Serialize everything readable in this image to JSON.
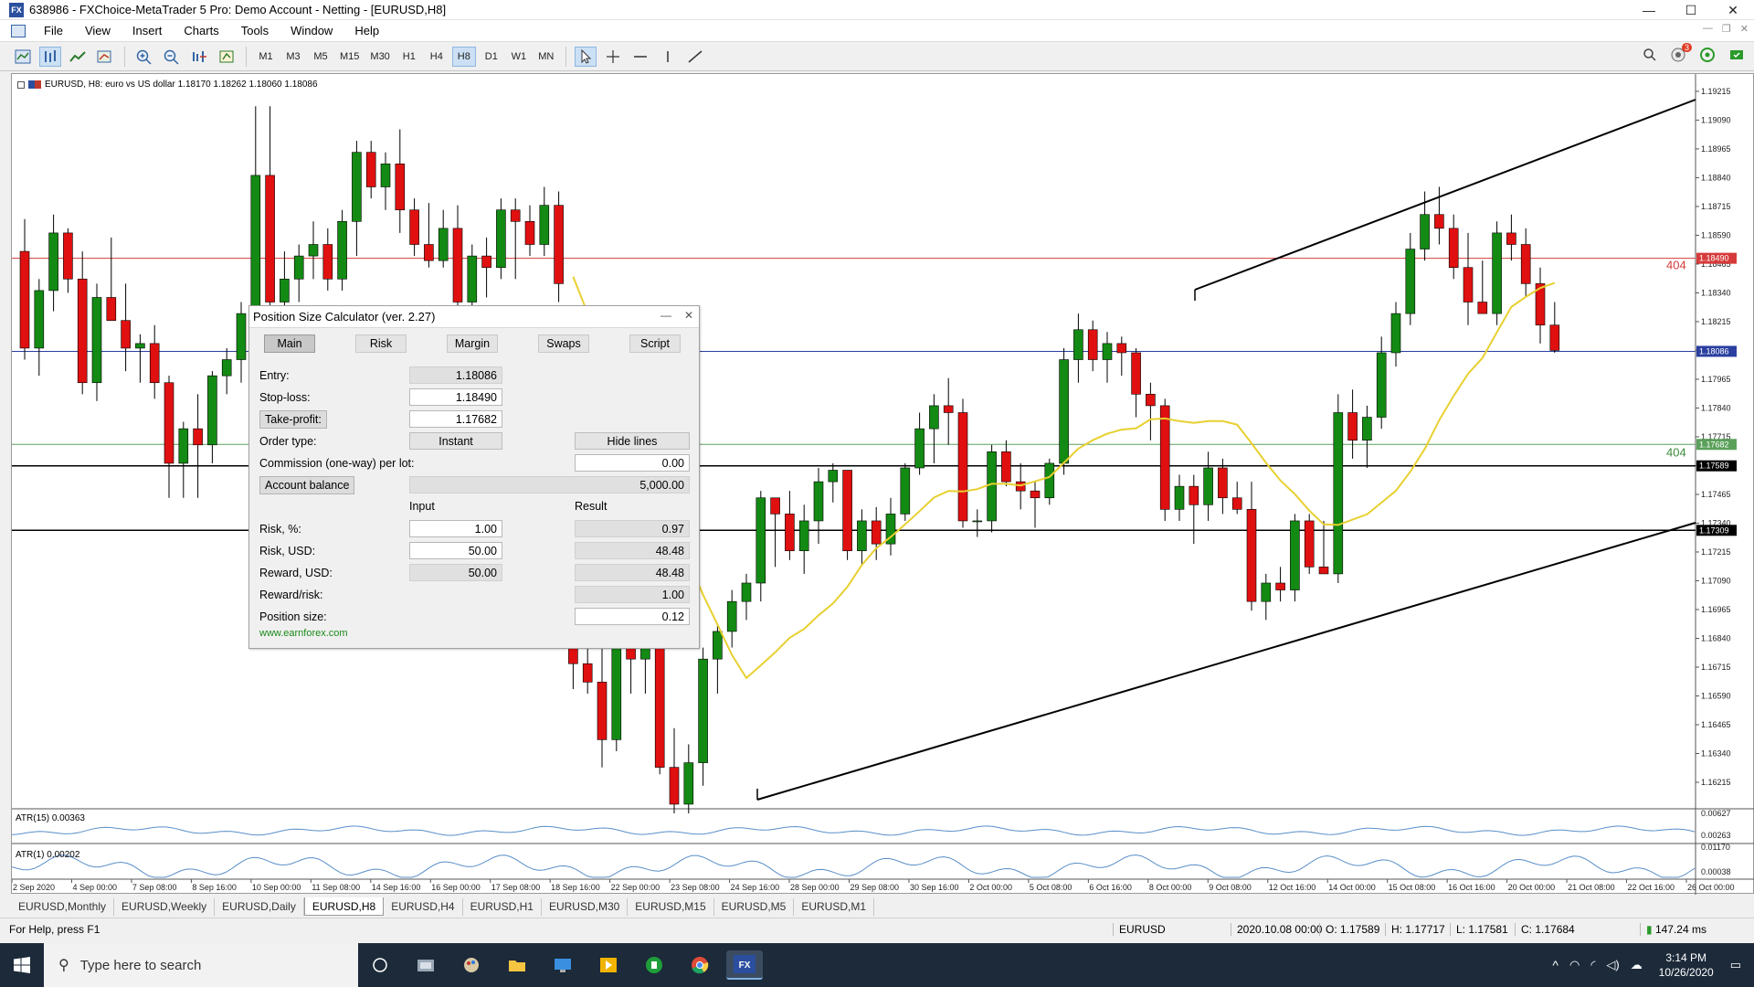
{
  "window": {
    "title": "638986 - FXChoice-MetaTrader 5 Pro: Demo Account - Netting - [EURUSD,H8]",
    "controls": [
      "—",
      "☐",
      "✕"
    ]
  },
  "menu": [
    "File",
    "View",
    "Insert",
    "Charts",
    "Tools",
    "Window",
    "Help"
  ],
  "toolbar": {
    "timeframes": [
      "M1",
      "M3",
      "M5",
      "M15",
      "M30",
      "H1",
      "H4",
      "H8",
      "D1",
      "W1",
      "MN"
    ],
    "active_timeframe": "H8",
    "notification_count": "3"
  },
  "chart": {
    "header": "EURUSD, H8:  euro vs US dollar  1.18170 1.18262 1.18060 1.18086",
    "price_axis": [
      "1.19215",
      "1.19090",
      "1.18965",
      "1.18840",
      "1.18715",
      "1.18590",
      "1.18465",
      "1.18340",
      "1.18215",
      "1.18090",
      "1.17965",
      "1.17840",
      "1.17715",
      "1.17590",
      "1.17465",
      "1.17340",
      "1.17215",
      "1.17090",
      "1.16965",
      "1.16840",
      "1.16715",
      "1.16590",
      "1.16465",
      "1.16340",
      "1.16215"
    ],
    "price_tags": {
      "stop_loss": "1.18490",
      "current": "1.18086",
      "take_profit": "1.17682",
      "line_1": "1.17589",
      "line_2": "1.17309"
    },
    "line_labels": {
      "sl_points": "404",
      "tp_points": "404"
    },
    "time_axis": [
      "2 Sep 2020",
      "4 Sep 00:00",
      "7 Sep 08:00",
      "8 Sep 16:00",
      "10 Sep 00:00",
      "11 Sep 08:00",
      "14 Sep 16:00",
      "16 Sep 00:00",
      "17 Sep 08:00",
      "18 Sep 16:00",
      "22 Sep 00:00",
      "23 Sep 08:00",
      "24 Sep 16:00",
      "28 Sep 00:00",
      "29 Sep 08:00",
      "30 Sep 16:00",
      "2 Oct 00:00",
      "5 Oct 08:00",
      "6 Oct 16:00",
      "8 Oct 00:00",
      "9 Oct 08:00",
      "12 Oct 16:00",
      "14 Oct 00:00",
      "15 Oct 08:00",
      "16 Oct 16:00",
      "20 Oct 00:00",
      "21 Oct 08:00",
      "22 Oct 16:00",
      "26 Oct 00:00"
    ],
    "atr15": {
      "label": "ATR(15) 0.00363",
      "axis": [
        "0.00627",
        "0.00263"
      ]
    },
    "atr1": {
      "label": "ATR(1) 0.00202",
      "axis": [
        "0.01170",
        "0.00038"
      ]
    }
  },
  "chart_data": {
    "type": "candlestick",
    "symbol": "EURUSD",
    "timeframe": "H8",
    "ylim": [
      1.161,
      1.1929
    ],
    "candles": [
      [
        1.1852,
        1.1866,
        1.1805,
        1.181
      ],
      [
        1.181,
        1.184,
        1.1798,
        1.1835
      ],
      [
        1.1835,
        1.1868,
        1.1826,
        1.186
      ],
      [
        1.186,
        1.1862,
        1.1834,
        1.184
      ],
      [
        1.184,
        1.1852,
        1.179,
        1.1795
      ],
      [
        1.1795,
        1.1838,
        1.1787,
        1.1832
      ],
      [
        1.1832,
        1.1858,
        1.1827,
        1.1822
      ],
      [
        1.1822,
        1.1838,
        1.18,
        1.181
      ],
      [
        1.181,
        1.1816,
        1.1795,
        1.1812
      ],
      [
        1.1812,
        1.182,
        1.1788,
        1.1795
      ],
      [
        1.1795,
        1.1798,
        1.1745,
        1.176
      ],
      [
        1.176,
        1.1778,
        1.1745,
        1.1775
      ],
      [
        1.1775,
        1.179,
        1.1745,
        1.1768
      ],
      [
        1.1768,
        1.18,
        1.176,
        1.1798
      ],
      [
        1.1798,
        1.181,
        1.179,
        1.1805
      ],
      [
        1.1805,
        1.183,
        1.1795,
        1.1825
      ],
      [
        1.1825,
        1.1915,
        1.182,
        1.1885
      ],
      [
        1.1885,
        1.1915,
        1.182,
        1.183
      ],
      [
        1.183,
        1.1852,
        1.181,
        1.184
      ],
      [
        1.184,
        1.1855,
        1.183,
        1.185
      ],
      [
        1.185,
        1.1865,
        1.184,
        1.1855
      ],
      [
        1.1855,
        1.1862,
        1.1835,
        1.184
      ],
      [
        1.184,
        1.187,
        1.1835,
        1.1865
      ],
      [
        1.1865,
        1.19,
        1.185,
        1.1895
      ],
      [
        1.1895,
        1.19,
        1.1875,
        1.188
      ],
      [
        1.188,
        1.1895,
        1.187,
        1.189
      ],
      [
        1.189,
        1.1905,
        1.186,
        1.187
      ],
      [
        1.187,
        1.1875,
        1.185,
        1.1855
      ],
      [
        1.1855,
        1.1873,
        1.1845,
        1.1848
      ],
      [
        1.1848,
        1.187,
        1.1845,
        1.1862
      ],
      [
        1.1862,
        1.1872,
        1.182,
        1.183
      ],
      [
        1.183,
        1.1855,
        1.1825,
        1.185
      ],
      [
        1.185,
        1.1858,
        1.1832,
        1.1845
      ],
      [
        1.1845,
        1.1875,
        1.184,
        1.187
      ],
      [
        1.187,
        1.1875,
        1.184,
        1.1865
      ],
      [
        1.1865,
        1.1872,
        1.185,
        1.1855
      ],
      [
        1.1855,
        1.188,
        1.185,
        1.1872
      ],
      [
        1.1872,
        1.1878,
        1.183,
        1.1838
      ],
      [
        1.1712,
        1.1725,
        1.1662,
        1.1673
      ],
      [
        1.1673,
        1.1688,
        1.166,
        1.1665
      ],
      [
        1.1665,
        1.1682,
        1.1628,
        1.164
      ],
      [
        1.164,
        1.169,
        1.1635,
        1.1685
      ],
      [
        1.1685,
        1.1698,
        1.166,
        1.1675
      ],
      [
        1.1675,
        1.1695,
        1.166,
        1.169
      ],
      [
        1.169,
        1.1695,
        1.1625,
        1.1628
      ],
      [
        1.1628,
        1.1645,
        1.1608,
        1.1612
      ],
      [
        1.1612,
        1.1638,
        1.1608,
        1.163
      ],
      [
        1.163,
        1.168,
        1.162,
        1.1675
      ],
      [
        1.1675,
        1.169,
        1.166,
        1.1687
      ],
      [
        1.1687,
        1.1705,
        1.168,
        1.17
      ],
      [
        1.17,
        1.1712,
        1.1692,
        1.1708
      ],
      [
        1.1708,
        1.1748,
        1.17,
        1.1745
      ],
      [
        1.1745,
        1.174,
        1.1715,
        1.1738
      ],
      [
        1.1738,
        1.1748,
        1.1718,
        1.1722
      ],
      [
        1.1722,
        1.1742,
        1.1712,
        1.1735
      ],
      [
        1.1735,
        1.1758,
        1.1725,
        1.1752
      ],
      [
        1.1752,
        1.176,
        1.1743,
        1.1757
      ],
      [
        1.1757,
        1.1752,
        1.1718,
        1.1722
      ],
      [
        1.1722,
        1.174,
        1.1716,
        1.1735
      ],
      [
        1.1735,
        1.1741,
        1.1718,
        1.1725
      ],
      [
        1.1725,
        1.1745,
        1.172,
        1.1738
      ],
      [
        1.1738,
        1.176,
        1.1735,
        1.1758
      ],
      [
        1.1758,
        1.1782,
        1.1755,
        1.1775
      ],
      [
        1.1775,
        1.179,
        1.176,
        1.1785
      ],
      [
        1.1785,
        1.1797,
        1.1768,
        1.1782
      ],
      [
        1.1782,
        1.1788,
        1.1732,
        1.1735
      ],
      [
        1.1735,
        1.174,
        1.1728,
        1.1735
      ],
      [
        1.1735,
        1.1768,
        1.173,
        1.1765
      ],
      [
        1.1765,
        1.177,
        1.175,
        1.1752
      ],
      [
        1.1752,
        1.176,
        1.174,
        1.1748
      ],
      [
        1.1748,
        1.1752,
        1.1732,
        1.1745
      ],
      [
        1.1745,
        1.1762,
        1.1742,
        1.176
      ],
      [
        1.176,
        1.181,
        1.1755,
        1.1805
      ],
      [
        1.1805,
        1.1825,
        1.1795,
        1.1818
      ],
      [
        1.1818,
        1.1822,
        1.18,
        1.1805
      ],
      [
        1.1805,
        1.1817,
        1.1795,
        1.1812
      ],
      [
        1.1812,
        1.1815,
        1.1798,
        1.1808
      ],
      [
        1.1808,
        1.181,
        1.178,
        1.179
      ],
      [
        1.179,
        1.1795,
        1.177,
        1.1785
      ],
      [
        1.1785,
        1.1788,
        1.1735,
        1.174
      ],
      [
        1.174,
        1.1755,
        1.1735,
        1.175
      ],
      [
        1.175,
        1.1755,
        1.1725,
        1.1742
      ],
      [
        1.1742,
        1.1765,
        1.1735,
        1.1758
      ],
      [
        1.1758,
        1.1762,
        1.1738,
        1.1745
      ],
      [
        1.1745,
        1.1752,
        1.1738,
        1.174
      ],
      [
        1.174,
        1.1752,
        1.1696,
        1.17
      ],
      [
        1.17,
        1.1712,
        1.1692,
        1.1708
      ],
      [
        1.1708,
        1.1715,
        1.17,
        1.1705
      ],
      [
        1.1705,
        1.1738,
        1.17,
        1.1735
      ],
      [
        1.1735,
        1.1738,
        1.1712,
        1.1715
      ],
      [
        1.1715,
        1.1735,
        1.1712,
        1.1712
      ],
      [
        1.1712,
        1.179,
        1.1708,
        1.1782
      ],
      [
        1.1782,
        1.1792,
        1.1762,
        1.177
      ],
      [
        1.177,
        1.1785,
        1.1758,
        1.178
      ],
      [
        1.178,
        1.1815,
        1.1775,
        1.1808
      ],
      [
        1.1808,
        1.183,
        1.1802,
        1.1825
      ],
      [
        1.1825,
        1.186,
        1.182,
        1.1853
      ],
      [
        1.1853,
        1.1878,
        1.1848,
        1.1868
      ],
      [
        1.1868,
        1.188,
        1.1855,
        1.1862
      ],
      [
        1.1862,
        1.1868,
        1.184,
        1.1845
      ],
      [
        1.1845,
        1.186,
        1.182,
        1.183
      ],
      [
        1.183,
        1.1848,
        1.1825,
        1.1825
      ],
      [
        1.1825,
        1.1865,
        1.182,
        1.186
      ],
      [
        1.186,
        1.1868,
        1.1848,
        1.1855
      ],
      [
        1.1855,
        1.1862,
        1.1832,
        1.1838
      ],
      [
        1.1838,
        1.1845,
        1.1812,
        1.182
      ],
      [
        1.182,
        1.183,
        1.1808,
        1.1809
      ]
    ],
    "series": [
      {
        "name": "ATR(15)",
        "values": [
          0.00363
        ]
      },
      {
        "name": "ATR(1)",
        "values": [
          0.00202
        ]
      }
    ]
  },
  "psc": {
    "title": "Position Size Calculator (ver. 2.27)",
    "tabs": [
      "Main",
      "Risk",
      "Margin",
      "Swaps",
      "Script"
    ],
    "entry_label": "Entry:",
    "entry": "1.18086",
    "sl_label": "Stop-loss:",
    "sl": "1.18490",
    "tp_label": "Take-profit:",
    "tp": "1.17682",
    "order_type_label": "Order type:",
    "order_type": "Instant",
    "hide_lines": "Hide lines",
    "commission_label": "Commission (one-way) per lot:",
    "commission": "0.00",
    "account_balance_label": "Account balance",
    "account_balance": "5,000.00",
    "input_header": "Input",
    "result_header": "Result",
    "risk_pct_label": "Risk, %:",
    "risk_pct_input": "1.00",
    "risk_pct_result": "0.97",
    "risk_usd_label": "Risk, USD:",
    "risk_usd_input": "50.00",
    "risk_usd_result": "48.48",
    "reward_usd_label": "Reward, USD:",
    "reward_usd_input": "50.00",
    "reward_usd_result": "48.48",
    "rr_label": "Reward/risk:",
    "rr_result": "1.00",
    "pos_size_label": "Position size:",
    "pos_size": "0.12",
    "link": "www.earnforex.com"
  },
  "chart_tabs": [
    "EURUSD,Monthly",
    "EURUSD,Weekly",
    "EURUSD,Daily",
    "EURUSD,H8",
    "EURUSD,H4",
    "EURUSD,H1",
    "EURUSD,M30",
    "EURUSD,M15",
    "EURUSD,M5",
    "EURUSD,M1"
  ],
  "status": {
    "help": "For Help, press F1",
    "symbol": "EURUSD",
    "time": "2020.10.08 00:00",
    "open": "O: 1.17589",
    "high": "H: 1.17717",
    "low": "L: 1.17581",
    "close": "C: 1.17684",
    "ping": "147.24 ms"
  },
  "taskbar": {
    "search_placeholder": "Type here to search",
    "time": "3:14 PM",
    "date": "10/26/2020"
  },
  "colors": {
    "bull": "#138a13",
    "bear": "#e01010",
    "ma": "#e8d030",
    "sl_line": "#d63a3a",
    "current_line": "#2a3fa0"
  }
}
